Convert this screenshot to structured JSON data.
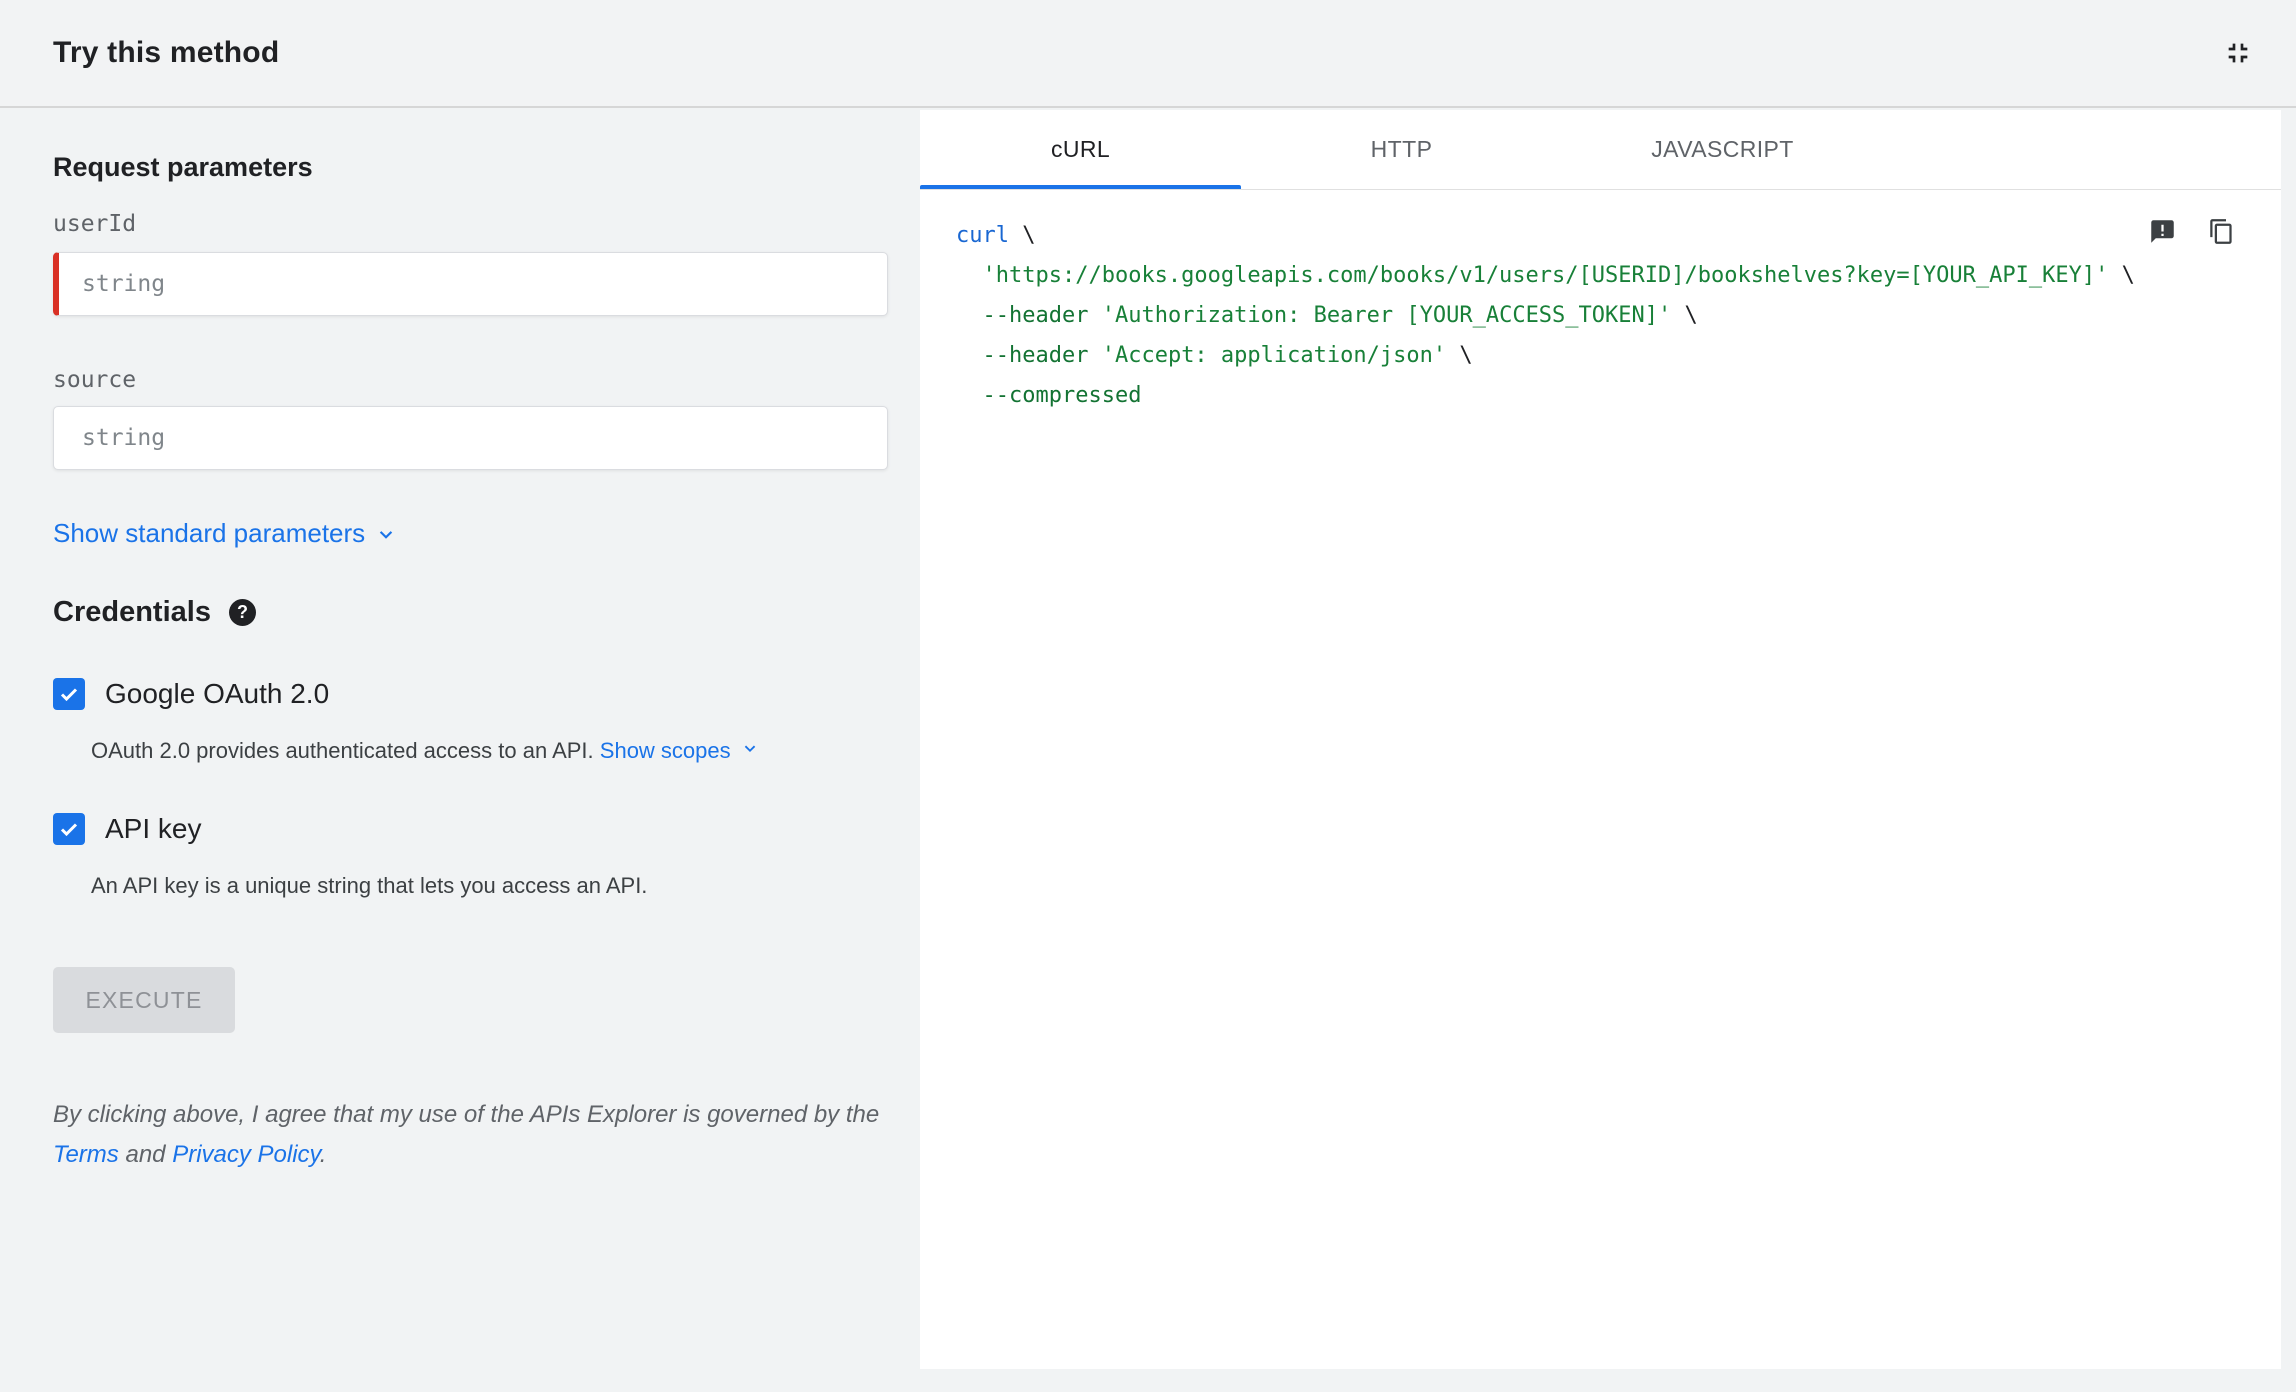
{
  "header": {
    "title": "Try this method"
  },
  "params": {
    "heading": "Request parameters",
    "fields": [
      {
        "label": "userId",
        "placeholder": "string",
        "required": true
      },
      {
        "label": "source",
        "placeholder": "string",
        "required": false
      }
    ],
    "show_standard": "Show standard parameters"
  },
  "credentials": {
    "heading": "Credentials",
    "oauth": {
      "label": "Google OAuth 2.0",
      "checked": true,
      "description": "OAuth 2.0 provides authenticated access to an API.",
      "show_scopes": "Show scopes"
    },
    "api_key": {
      "label": "API key",
      "checked": true,
      "description": "An API key is a unique string that lets you access an API."
    }
  },
  "execute": {
    "label": "EXECUTE",
    "disabled": true
  },
  "disclaimer": {
    "text": "By clicking above, I agree that my use of the APIs Explorer is governed by the ",
    "terms": "Terms",
    "and": " and ",
    "privacy": "Privacy Policy",
    "period": "."
  },
  "code_panel": {
    "tabs": [
      {
        "label": "cURL",
        "active": true
      },
      {
        "label": "HTTP",
        "active": false
      },
      {
        "label": "JAVASCRIPT",
        "active": false
      }
    ],
    "lines": [
      [
        {
          "t": "curl",
          "c": "kw"
        },
        {
          "t": " \\",
          "c": "pln"
        }
      ],
      [
        {
          "t": "  ",
          "c": "pln"
        },
        {
          "t": "'https://books.googleapis.com/books/v1/users/[USERID]/bookshelves?key=[YOUR_API_KEY]'",
          "c": "str"
        },
        {
          "t": " \\",
          "c": "pln"
        }
      ],
      [
        {
          "t": "  ",
          "c": "pln"
        },
        {
          "t": "--header ",
          "c": "flag"
        },
        {
          "t": "'Authorization: Bearer [YOUR_ACCESS_TOKEN]'",
          "c": "str"
        },
        {
          "t": " \\",
          "c": "pln"
        }
      ],
      [
        {
          "t": "  ",
          "c": "pln"
        },
        {
          "t": "--header ",
          "c": "flag"
        },
        {
          "t": "'Accept: application/json'",
          "c": "str"
        },
        {
          "t": " \\",
          "c": "pln"
        }
      ],
      [
        {
          "t": "  ",
          "c": "pln"
        },
        {
          "t": "--compressed",
          "c": "flag"
        }
      ]
    ]
  },
  "colors": {
    "accent_blue": "#1a73e8",
    "required_red": "#d93025",
    "panel_gray": "#f1f3f4",
    "code_keyword": "#1967d2",
    "code_string": "#188038",
    "code_flag": "#137333"
  }
}
